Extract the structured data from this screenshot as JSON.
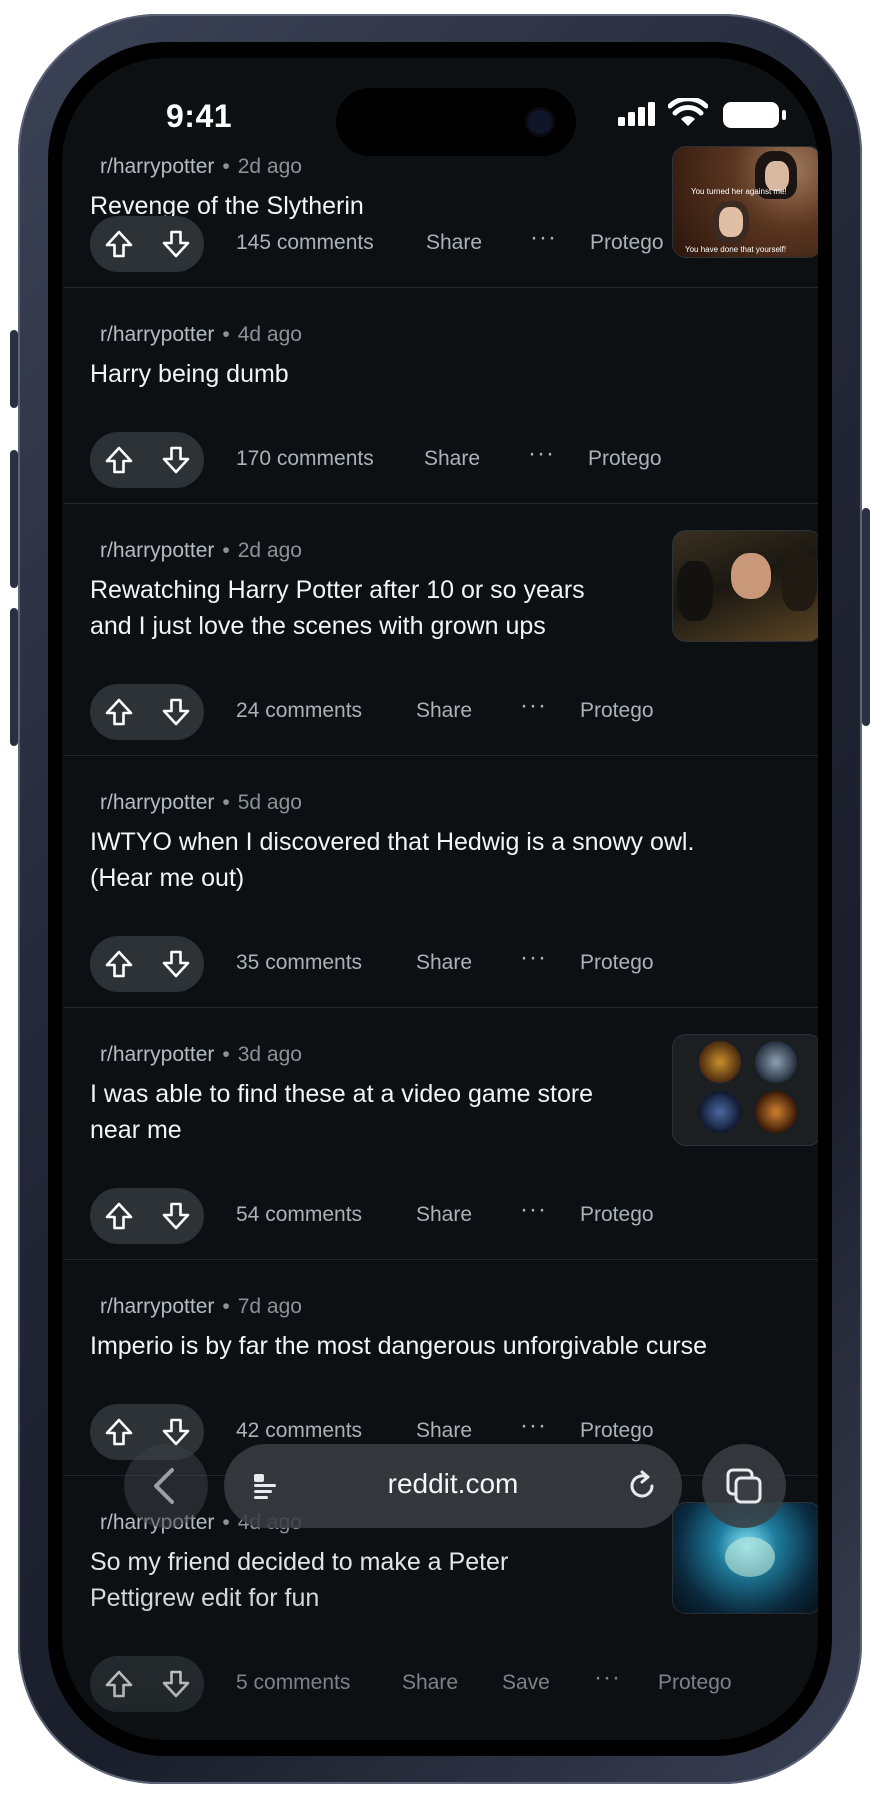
{
  "status_bar": {
    "time": "9:41"
  },
  "posts": [
    {
      "subreddit": "r/harrypotter",
      "age": "2d ago",
      "title_lines": [
        "Revenge of the Slytherin"
      ],
      "has_thumb": true,
      "thumb_text": [
        "You turned her against me!",
        "You have done that yourself!"
      ],
      "comments": "145 comments",
      "share": "Share",
      "more": "···",
      "award": "Protego"
    },
    {
      "subreddit": "r/harrypotter",
      "age": "4d ago",
      "title_lines": [
        "Harry being dumb"
      ],
      "has_thumb": false,
      "comments": "170 comments",
      "share": "Share",
      "more": "···",
      "award": "Protego"
    },
    {
      "subreddit": "r/harrypotter",
      "age": "2d ago",
      "title_lines": [
        "Rewatching Harry Potter after 10 or so years",
        "and I just love the scenes with grown ups"
      ],
      "has_thumb": true,
      "comments": "24 comments",
      "share": "Share",
      "more": "···",
      "award": "Protego"
    },
    {
      "subreddit": "r/harrypotter",
      "age": "5d ago",
      "title_lines": [
        "IWTYO when I discovered that Hedwig is a snowy owl.",
        "(Hear me out)"
      ],
      "has_thumb": false,
      "comments": "35 comments",
      "share": "Share",
      "more": "···",
      "award": "Protego"
    },
    {
      "subreddit": "r/harrypotter",
      "age": "3d ago",
      "title_lines": [
        "I was able to find these at a video game store",
        "near me"
      ],
      "has_thumb": true,
      "comments": "54 comments",
      "share": "Share",
      "more": "···",
      "award": "Protego"
    },
    {
      "subreddit": "r/harrypotter",
      "age": "7d ago",
      "title_lines": [
        "Imperio is by far the most dangerous unforgivable curse"
      ],
      "has_thumb": false,
      "comments": "42 comments",
      "share": "Share",
      "more": "···",
      "award": "Protego"
    },
    {
      "subreddit": "r/harrypotter",
      "age": "4d ago",
      "title_lines": [
        "So my friend decided to make a Peter",
        "Pettigrew edit for fun"
      ],
      "has_thumb": true,
      "comments": "5 comments",
      "share": "Share",
      "save": "Save",
      "more": "···",
      "award": "Protego"
    }
  ],
  "browser": {
    "url": "reddit.com"
  }
}
